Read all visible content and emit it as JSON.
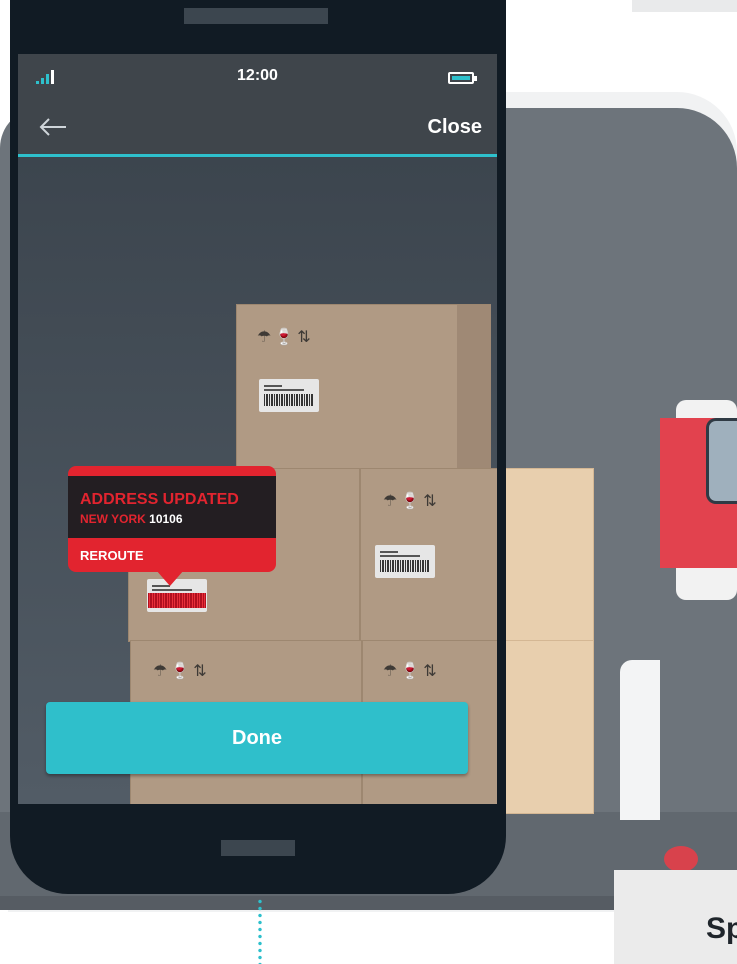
{
  "status_bar": {
    "time": "12:00",
    "signal_icon": "signal-bars-icon",
    "battery_icon": "battery-icon"
  },
  "app_bar": {
    "back_icon": "back-arrow-icon",
    "close_label": "Close"
  },
  "popup": {
    "title": "ADDRESS UPDATED",
    "city": "NEW YORK",
    "zip": "10106",
    "action": "REROUTE"
  },
  "done_button": {
    "label": "Done"
  },
  "side_card": {
    "text": "Sp"
  },
  "colors": {
    "accent": "#2ec0cc",
    "alert_red": "#e2242f",
    "popup_dark": "#231e22",
    "screen_bar": "#3f454b"
  },
  "package_icons": "umbrella-glass-arrows-icon"
}
